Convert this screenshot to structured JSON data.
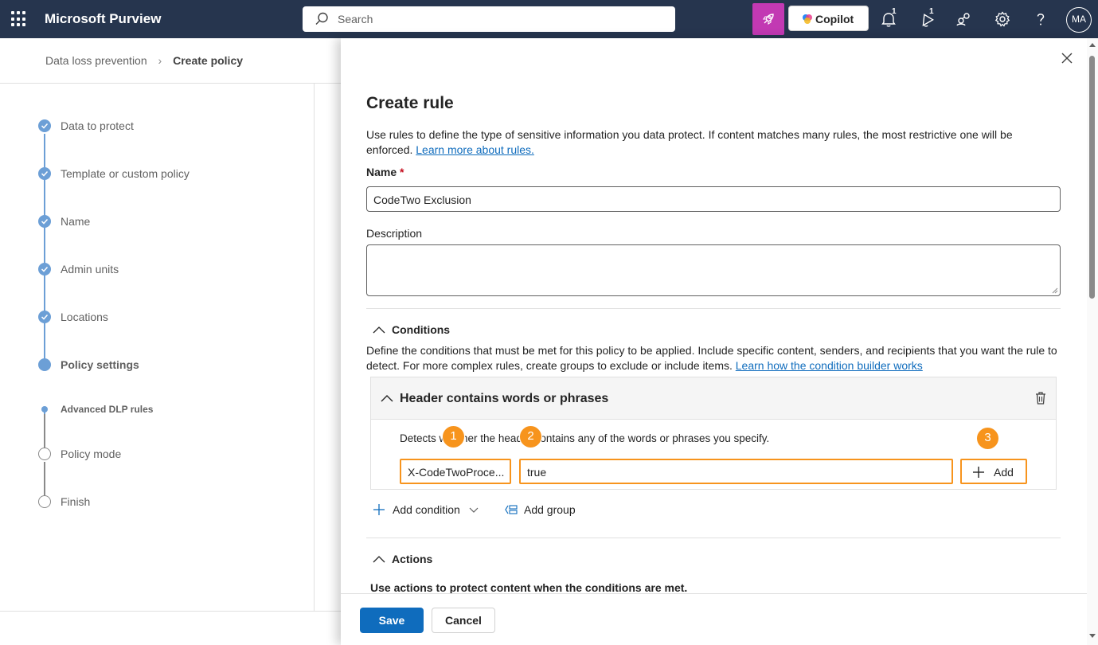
{
  "topbar": {
    "app_title": "Microsoft Purview",
    "search_placeholder": "Search",
    "copilot_label": "Copilot",
    "notifications_badge": "1",
    "whats_new_badge": "1",
    "avatar_initials": "MA",
    "brand_color": "#26354e",
    "accent_color": "#c239b3"
  },
  "breadcrumb": {
    "items": [
      "Data loss prevention"
    ],
    "current": "Create policy"
  },
  "steps": [
    {
      "label": "Data to protect",
      "state": "done"
    },
    {
      "label": "Template or custom policy",
      "state": "done"
    },
    {
      "label": "Name",
      "state": "done"
    },
    {
      "label": "Admin units",
      "state": "done"
    },
    {
      "label": "Locations",
      "state": "done"
    },
    {
      "label": "Policy settings",
      "state": "current"
    },
    {
      "label": "Advanced DLP rules",
      "state": "substep"
    },
    {
      "label": "Policy mode",
      "state": "pending"
    },
    {
      "label": "Finish",
      "state": "pending"
    }
  ],
  "panel": {
    "title": "Create rule",
    "description": "Use rules to define the type of sensitive information you data protect. If content matches many rules, the most restrictive one will be enforced.",
    "description_link": "Learn more about rules.",
    "name_label": "Name",
    "required_mark": "*",
    "name_value": "CodeTwo Exclusion",
    "description_label": "Description",
    "description_value": "",
    "conditions": {
      "heading": "Conditions",
      "description": "Define the conditions that must be met for this policy to be applied. Include specific content, senders, and recipients that you want the rule to detect. For more complex rules, create groups to exclude or include items.",
      "description_link": "Learn how the condition builder works",
      "card_title": "Header contains words or phrases",
      "card_description": "Detects whether the header contains any of the words or phrases you specify.",
      "header_name_value": "X-CodeTwoProce...",
      "header_value": "true",
      "add_label": "Add",
      "markers": [
        "1",
        "2",
        "3"
      ],
      "add_condition_label": "Add condition",
      "add_group_label": "Add group"
    },
    "actions": {
      "heading": "Actions",
      "description": "Use actions to protect content when the conditions are met."
    },
    "footer": {
      "save_label": "Save",
      "cancel_label": "Cancel"
    },
    "highlight_color": "#f7941d",
    "primary_color": "#0f6cbd"
  }
}
